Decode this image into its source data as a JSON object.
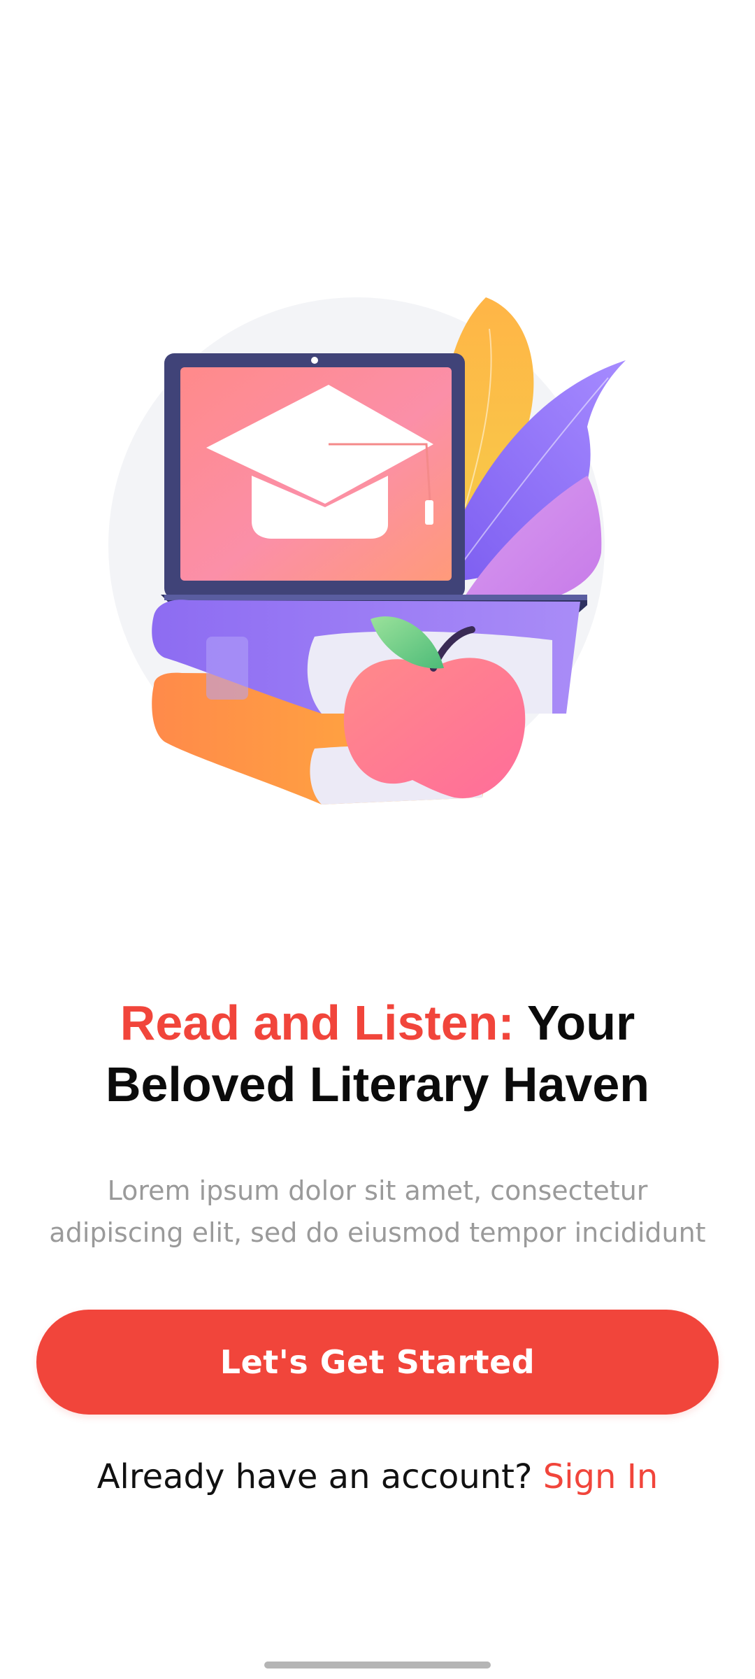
{
  "onboarding": {
    "headline_accent": "Read and Listen:",
    "headline_rest_line1": "Your",
    "headline_line2": "Beloved Literary Haven",
    "subtitle_line1": "Lorem ipsum dolor sit amet, consectetur",
    "subtitle_line2": "adipiscing elit, sed do eiusmod tempor incididunt",
    "cta_label": "Let's Get Started",
    "account_prompt": "Already have an account?",
    "signin_label": "Sign In"
  },
  "illustration": {
    "icons": [
      "laptop-icon",
      "graduation-cap-icon",
      "books-icon",
      "apple-icon",
      "leaves-icon"
    ]
  },
  "colors": {
    "accent": "#f1453b",
    "headline_text": "#0b0b0b",
    "subtitle_text": "#9a9a9a",
    "background": "#ffffff"
  }
}
